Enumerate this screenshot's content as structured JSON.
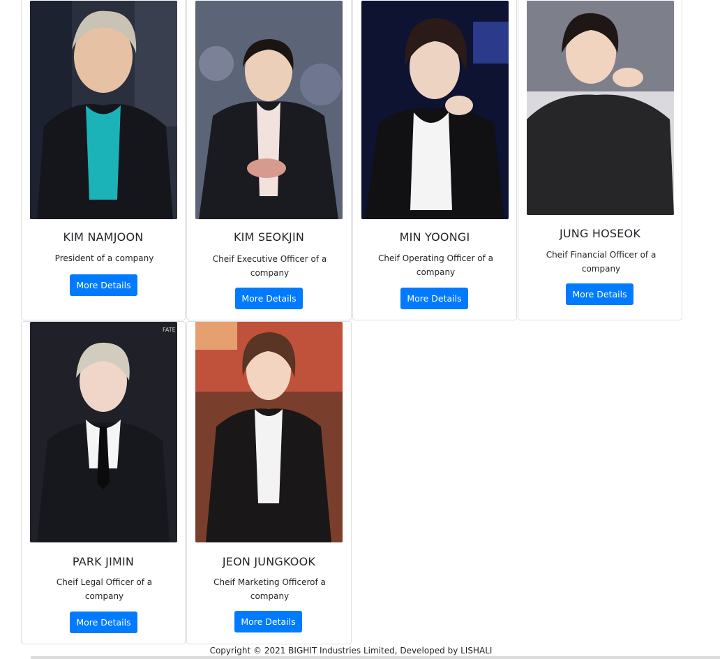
{
  "cards": [
    {
      "name": "KIM NAMJOON",
      "role": "President of a company",
      "button": "More Details"
    },
    {
      "name": "KIM SEOKJIN",
      "role": "Cheif Executive Officer of a company",
      "button": "More Details"
    },
    {
      "name": "MIN YOONGI",
      "role": "Cheif Operating Officer of a company",
      "button": "More Details"
    },
    {
      "name": "JUNG HOSEOK",
      "role": "Cheif Financial Officer of a company",
      "button": "More Details"
    },
    {
      "name": "PARK JIMIN",
      "role": "Cheif Legal Officer of a company",
      "button": "More Details"
    },
    {
      "name": "JEON JUNGKOOK",
      "role": "Cheif Marketing Officerof a company",
      "button": "More Details"
    }
  ],
  "footer": {
    "text": "Copyright © 2021 BIGHIT Industries Limited, Developed by LISHALI"
  },
  "colors": {
    "primary": "#007bff",
    "card_border": "#dee2e6"
  }
}
